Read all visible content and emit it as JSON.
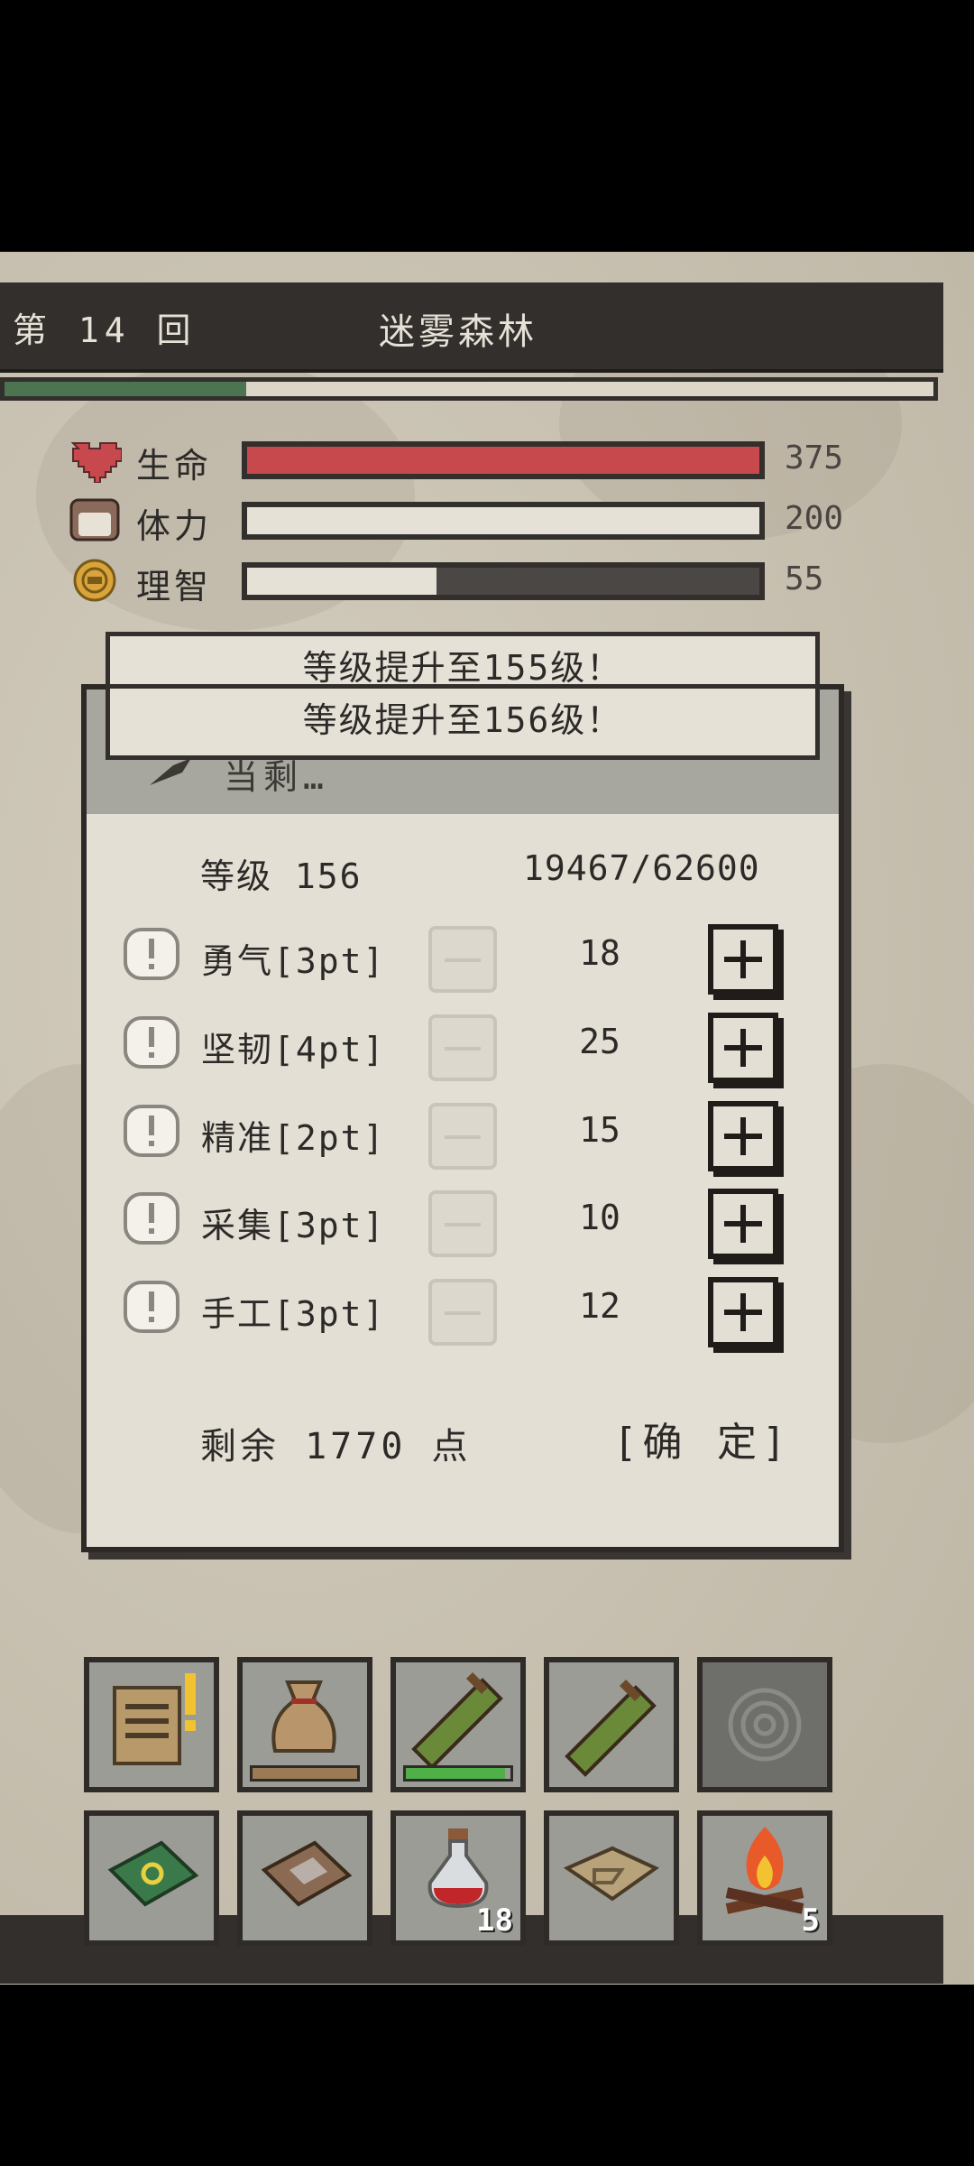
{
  "header": {
    "round_label": "第 14 回",
    "location": "迷雾森林"
  },
  "stage_progress": 0.26,
  "stats": [
    {
      "name": "生命",
      "icon": "heart-icon",
      "value": "375",
      "fill": 1.0,
      "color": "#c8494d"
    },
    {
      "name": "体力",
      "icon": "stamina-icon",
      "value": "200",
      "fill": 1.0,
      "color": "#e6e1d6"
    },
    {
      "name": "理智",
      "icon": "sanity-icon",
      "value": "55",
      "fill": 0.37,
      "color": "#e6e1d6"
    }
  ],
  "notifications": [
    "等级提升至155级！",
    "等级提升至156级！"
  ],
  "dialog": {
    "header_partial": "当剩…",
    "level_label": "等级 156",
    "exp": "19467/62600",
    "attributes": [
      {
        "label": "勇气[3pt]",
        "value": "18"
      },
      {
        "label": "坚韧[4pt]",
        "value": "25"
      },
      {
        "label": "精准[2pt]",
        "value": "15"
      },
      {
        "label": "采集[3pt]",
        "value": "10"
      },
      {
        "label": "手工[3pt]",
        "value": "12"
      }
    ],
    "remaining": "剩余 1770 点",
    "confirm_label": "[确 定]"
  },
  "inventory": {
    "row1": [
      {
        "icon": "quest-scroll-icon",
        "alert": true
      },
      {
        "icon": "loot-bag-icon",
        "bar": 1.0,
        "bar_color": "#9a7b55"
      },
      {
        "icon": "herb-bundle-icon",
        "bar": 0.95,
        "bar_color": "#4fb048"
      },
      {
        "icon": "herb-bundle-icon",
        "bar": 0.0,
        "bar_color": "#4fb048"
      },
      {
        "icon": "empty-rune-icon",
        "dim": true
      }
    ],
    "row2": [
      {
        "icon": "spellbook-icon"
      },
      {
        "icon": "journal-icon"
      },
      {
        "icon": "potion-icon",
        "count": "18"
      },
      {
        "icon": "map-icon"
      },
      {
        "icon": "campfire-icon",
        "count": "5"
      }
    ]
  }
}
